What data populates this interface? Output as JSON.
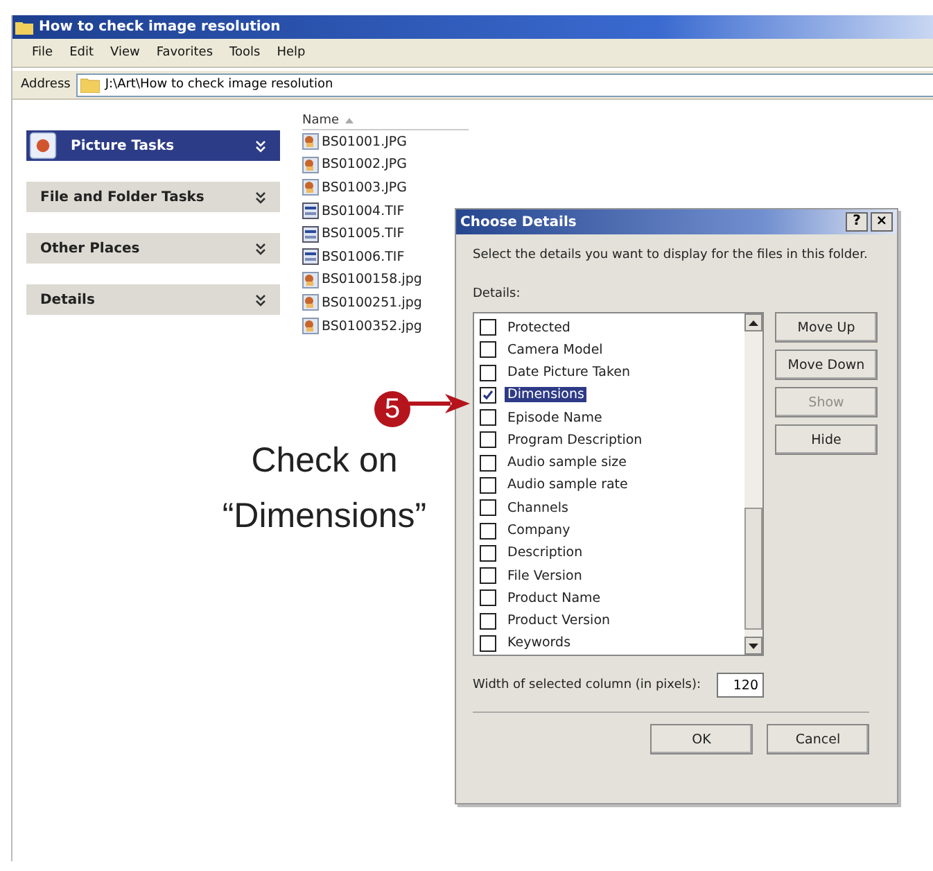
{
  "window": {
    "title": "How to check image resolution"
  },
  "menu": [
    "File",
    "Edit",
    "View",
    "Favorites",
    "Tools",
    "Help"
  ],
  "address": {
    "label": "Address",
    "value": "J:\\Art\\How to check image resolution"
  },
  "sidebar": {
    "items": [
      {
        "label": "Picture Tasks",
        "selected": true
      },
      {
        "label": "File and Folder Tasks",
        "selected": false
      },
      {
        "label": "Other Places",
        "selected": false
      },
      {
        "label": "Details",
        "selected": false
      }
    ]
  },
  "file_list": {
    "column": "Name",
    "items": [
      {
        "name": "BS01001.JPG",
        "kind": "jpg"
      },
      {
        "name": "BS01002.JPG",
        "kind": "jpg"
      },
      {
        "name": "BS01003.JPG",
        "kind": "jpg"
      },
      {
        "name": "BS01004.TIF",
        "kind": "tif"
      },
      {
        "name": "BS01005.TIF",
        "kind": "tif"
      },
      {
        "name": "BS01006.TIF",
        "kind": "tif"
      },
      {
        "name": "BS0100158.jpg",
        "kind": "jpg"
      },
      {
        "name": "BS0100251.jpg",
        "kind": "jpg"
      },
      {
        "name": "BS0100352.jpg",
        "kind": "jpg"
      }
    ]
  },
  "dialog": {
    "title": "Choose Details",
    "help": "?",
    "close": "×",
    "description": "Select the details you want to display for the files in this folder.",
    "details_label": "Details:",
    "details": [
      {
        "label": "Protected",
        "checked": false,
        "selected": false
      },
      {
        "label": "Camera Model",
        "checked": false,
        "selected": false
      },
      {
        "label": "Date Picture Taken",
        "checked": false,
        "selected": false
      },
      {
        "label": "Dimensions",
        "checked": true,
        "selected": true
      },
      {
        "label": "Episode Name",
        "checked": false,
        "selected": false
      },
      {
        "label": "Program Description",
        "checked": false,
        "selected": false
      },
      {
        "label": "Audio sample size",
        "checked": false,
        "selected": false
      },
      {
        "label": "Audio sample rate",
        "checked": false,
        "selected": false
      },
      {
        "label": "Channels",
        "checked": false,
        "selected": false
      },
      {
        "label": "Company",
        "checked": false,
        "selected": false
      },
      {
        "label": "Description",
        "checked": false,
        "selected": false
      },
      {
        "label": "File Version",
        "checked": false,
        "selected": false
      },
      {
        "label": "Product Name",
        "checked": false,
        "selected": false
      },
      {
        "label": "Product Version",
        "checked": false,
        "selected": false
      },
      {
        "label": "Keywords",
        "checked": false,
        "selected": false
      }
    ],
    "side_buttons": [
      {
        "label": "Move Up",
        "disabled": false
      },
      {
        "label": "Move Down",
        "disabled": false
      },
      {
        "label": "Show",
        "disabled": true
      },
      {
        "label": "Hide",
        "disabled": false
      }
    ],
    "width_label": "Width of selected column (in pixels):",
    "width_value": "120",
    "buttons": [
      "OK",
      "Cancel"
    ]
  },
  "annotation": {
    "step": "5",
    "caption": "Check on “Dimensions”"
  }
}
